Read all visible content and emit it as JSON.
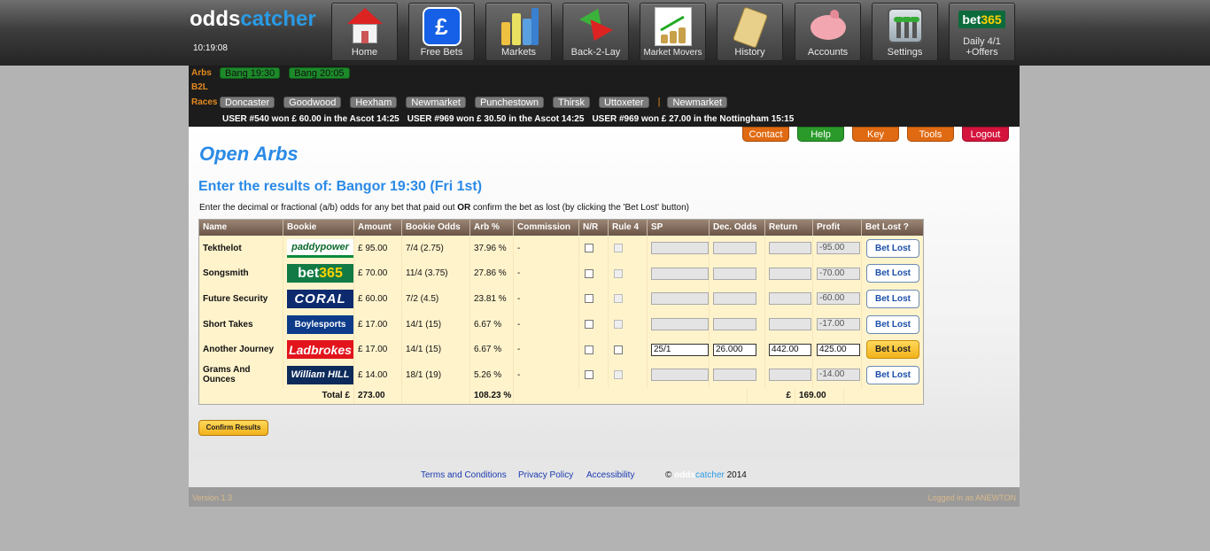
{
  "header": {
    "logo_odds": "odds",
    "logo_catcher": "catcher",
    "clock": "10:19:08",
    "nav": [
      {
        "label": "Home",
        "icon": "home-icon"
      },
      {
        "label": "Free Bets",
        "icon": "pound-icon"
      },
      {
        "label": "Markets",
        "icon": "bar-chart-icon"
      },
      {
        "label": "Back-2-Lay",
        "icon": "up-down-arrows-icon"
      },
      {
        "label": "Market Movers",
        "icon": "market-movers-icon"
      },
      {
        "label": "History",
        "icon": "scroll-icon"
      },
      {
        "label": "Accounts",
        "icon": "piggy-bank-icon"
      },
      {
        "label": "Settings",
        "icon": "sliders-icon"
      },
      {
        "label": "Daily 4/1",
        "label2": "+Offers",
        "icon": "bet365-logo"
      }
    ],
    "bet365_logo_a": "bet",
    "bet365_logo_b": "365"
  },
  "subnav": {
    "arbs_label": "Arbs",
    "arbs": [
      "Bang 19:30",
      "Bang 20:05"
    ],
    "b2l_label": "B2L",
    "races_label": "Races",
    "races": [
      "Doncaster",
      "Goodwood",
      "Hexham",
      "Newmarket",
      "Punchestown",
      "Thirsk",
      "Uttoxeter"
    ],
    "races_separator": "|",
    "races_extra": [
      "Newmarket"
    ],
    "ticker": [
      "USER #540 won £ 60.00 in the Ascot 14:25",
      "USER #969 won £ 30.50 in the Ascot 14:25",
      "USER #969 won £ 27.00 in the Nottingham 15:15"
    ]
  },
  "topbuttons": [
    {
      "label": "Contact",
      "color": "orange"
    },
    {
      "label": "Help",
      "color": "green"
    },
    {
      "label": "Key",
      "color": "orange"
    },
    {
      "label": "Tools",
      "color": "orange"
    },
    {
      "label": "Logout",
      "color": "red"
    }
  ],
  "main": {
    "title": "Open Arbs",
    "subtitle": "Enter the results of: Bangor 19:30 (Fri 1st)",
    "instructions_a": "Enter the decimal or fractional (a/b) odds for any bet that paid out ",
    "instructions_or": "OR",
    "instructions_b": " confirm the bet as lost (by clicking the 'Bet Lost' button)",
    "confirm_label": "Confirm Results"
  },
  "table": {
    "headers": [
      "Name",
      "Bookie",
      "Amount",
      "Bookie Odds",
      "Arb %",
      "Commission",
      "N/R",
      "Rule 4",
      "SP",
      "Dec. Odds",
      "Return",
      "Profit",
      "Bet Lost ?"
    ],
    "rows": [
      {
        "name": "Tekthelot",
        "bookie": "paddypower",
        "amount": "£ 95.00",
        "odds": "7/4 (2.75)",
        "arb": "37.96 %",
        "commission": "-",
        "sp": "",
        "dec": "",
        "ret": "",
        "profit": "-95.00",
        "active": false
      },
      {
        "name": "Songsmith",
        "bookie": "bet365",
        "amount": "£ 70.00",
        "odds": "11/4 (3.75)",
        "arb": "27.86 %",
        "commission": "-",
        "sp": "",
        "dec": "",
        "ret": "",
        "profit": "-70.00",
        "active": false
      },
      {
        "name": "Future Security",
        "bookie": "CORAL",
        "amount": "£ 60.00",
        "odds": "7/2 (4.5)",
        "arb": "23.81 %",
        "commission": "-",
        "sp": "",
        "dec": "",
        "ret": "",
        "profit": "-60.00",
        "active": false
      },
      {
        "name": "Short Takes",
        "bookie": "Boylesports",
        "amount": "£ 17.00",
        "odds": "14/1 (15)",
        "arb": "6.67 %",
        "commission": "-",
        "sp": "",
        "dec": "",
        "ret": "",
        "profit": "-17.00",
        "active": false
      },
      {
        "name": "Another Journey",
        "bookie": "Ladbrokes",
        "amount": "£ 17.00",
        "odds": "14/1 (15)",
        "arb": "6.67 %",
        "commission": "-",
        "sp": "25/1",
        "dec": "26.000",
        "ret": "442.00",
        "profit": "425.00",
        "active": true
      },
      {
        "name": "Grams And Ounces",
        "bookie": "William HILL",
        "amount": "£ 14.00",
        "odds": "18/1 (19)",
        "arb": "5.26 %",
        "commission": "-",
        "sp": "",
        "dec": "",
        "ret": "",
        "profit": "-14.00",
        "active": false
      }
    ],
    "bookie_bet365_a": "bet",
    "bookie_bet365_b": "365",
    "bet_lost_label": "Bet Lost",
    "total_label": "Total £",
    "total_amount": "273.00",
    "total_arb": "108.23 %",
    "total_profit_currency": "£",
    "total_profit": "169.00"
  },
  "footer": {
    "links": [
      "Terms and Conditions",
      "Privacy Policy",
      "Accessibility"
    ],
    "copyright_symbol": "©",
    "copyright_odds": "odds",
    "copyright_catcher": "catcher",
    "copyright_year": "2014",
    "version": "Version 1.3",
    "logged_in": "Logged in as ANEWTON"
  }
}
